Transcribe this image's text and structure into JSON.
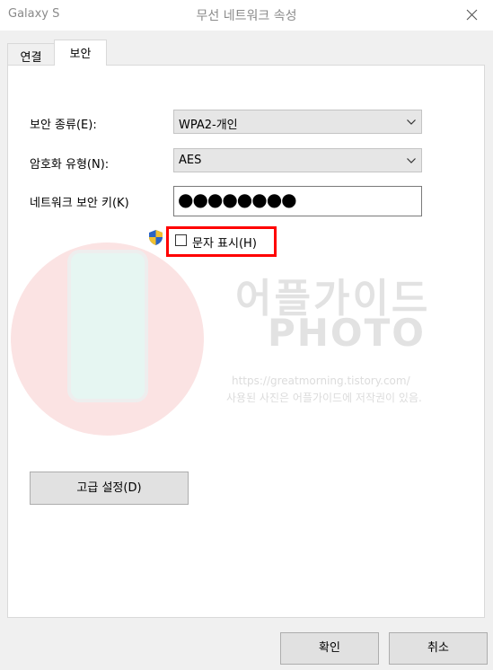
{
  "window": {
    "app_name": "Galaxy S",
    "title": "무선 네트워크 속성",
    "close_icon": "close-icon"
  },
  "tabs": [
    {
      "label": "연결",
      "active": false
    },
    {
      "label": "보안",
      "active": true
    }
  ],
  "form": {
    "security_type_label": "보안 종류(E):",
    "security_type_value": "WPA2-개인",
    "encryption_type_label": "암호화 유형(N):",
    "encryption_type_value": "AES",
    "network_key_label": "네트워크 보안 키(K)",
    "network_key_value": "●●●●●●●●",
    "show_characters_label": "문자 표시(H)",
    "show_characters_checked": false,
    "shield_icon": "uac-shield-icon"
  },
  "watermark": {
    "brand": "어플가이드",
    "photo": "PHOTO",
    "url": "https://greatmorning.tistory.com/",
    "note": "사용된 사진은 어플가이드에 저작권이 있음."
  },
  "buttons": {
    "advanced": "고급 설정(D)",
    "ok": "확인",
    "cancel": "취소"
  },
  "colors": {
    "highlight": "#ff0000",
    "window_bg": "#f0f0f0",
    "panel_bg": "#ffffff"
  }
}
